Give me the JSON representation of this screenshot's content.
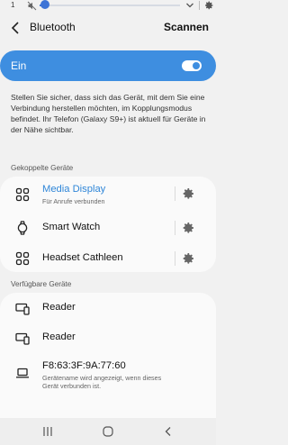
{
  "status_bar": {
    "notification_count": "1"
  },
  "header": {
    "title": "Bluetooth",
    "scan_label": "Scannen"
  },
  "toggle": {
    "label": "Ein",
    "state": "on",
    "accent": "#3e8ee0"
  },
  "info_text": "Stellen Sie sicher, dass sich das Gerät, mit dem Sie eine Verbindung herstellen möchten, im Kopplungsmodus befindet. Ihr Telefon (Galaxy S9+) ist aktuell für Geräte in der Nähe sichtbar.",
  "paired": {
    "label": "Gekoppelte Geräte",
    "devices": [
      {
        "name": "Media Display",
        "subtitle": "Für Anrufe verbunden",
        "icon": "grid-icon",
        "active": true
      },
      {
        "name": "Smart Watch",
        "icon": "watch-icon"
      },
      {
        "name": "Headset Cathleen",
        "icon": "grid-icon"
      }
    ]
  },
  "available": {
    "label": "Verfügbare Geräte",
    "devices": [
      {
        "name": "Reader",
        "icon": "devices-icon"
      },
      {
        "name": "Reader",
        "icon": "devices-icon"
      },
      {
        "name": "F8:63:3F:9A:77:60",
        "subtitle": "Gerätename wird angezeigt, wenn dieses Gerät verbunden ist.",
        "icon": "laptop-icon"
      }
    ]
  },
  "colors": {
    "accent": "#2f86d8",
    "background": "#f1f1f1",
    "card": "#fafafa"
  }
}
